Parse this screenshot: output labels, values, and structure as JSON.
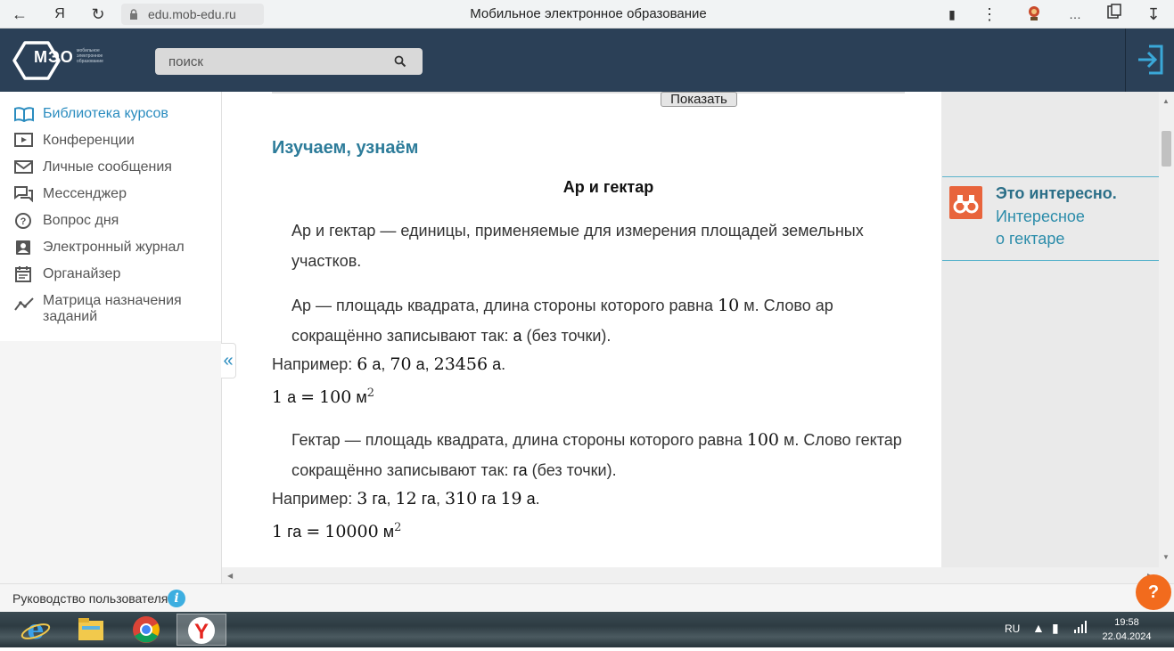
{
  "browser": {
    "url": "edu.mob-edu.ru",
    "title": "Мобильное электронное образование"
  },
  "header": {
    "logo_text": "МЭО",
    "logo_subtitle": "мобильное электронное образование",
    "search_placeholder": "поиск"
  },
  "sidebar": {
    "items": [
      {
        "label": "Библиотека курсов",
        "icon": "book-icon",
        "active": true
      },
      {
        "label": "Конференции",
        "icon": "video-play-icon"
      },
      {
        "label": "Личные сообщения",
        "icon": "mail-icon"
      },
      {
        "label": "Мессенджер",
        "icon": "chat-icon"
      },
      {
        "label": "Вопрос дня",
        "icon": "question-icon"
      },
      {
        "label": "Электронный журнал",
        "icon": "journal-icon"
      },
      {
        "label": "Органайзер",
        "icon": "calendar-icon"
      },
      {
        "label": "Матрица назначения заданий",
        "icon": "trend-icon"
      }
    ],
    "collapse_label": "«"
  },
  "content": {
    "show_button": "Показать",
    "section_title": "Изучаем, узнаём",
    "lesson_title": "Ар и гектар",
    "p1": "Ар и гектар — единицы, применяемые для измерения площадей земельных участков.",
    "p2_a": "Ар — площадь квадрата, длина стороны которого равна ",
    "p2_num": "10",
    "p2_unit": " м",
    "p2_b": ". Слово ар сокращённо записывают так: ",
    "p2_abbr": "а",
    "p2_c": " (без точки).",
    "ex1_label": "Например: ",
    "ex1_v1": "6",
    "ex1_v2": "70",
    "ex1_v3": "23456",
    "ex1_unit": "а",
    "eq1_l": "1",
    "eq1_lu": "а",
    "eq1_r": "100",
    "eq1_ru": "м",
    "p3_a": "Гектар — площадь квадрата, длина стороны которого равна ",
    "p3_num": "100",
    "p3_unit": " м",
    "p3_b": ". Слово гектар сокращённо записывают так: ",
    "p3_abbr": "га",
    "p3_c": " (без точки).",
    "ex2_label": "Например: ",
    "ex2_v1": "3",
    "ex2_v2": "12",
    "ex2_v3a": "310",
    "ex2_v3b": "19",
    "ex2_unit_ga": "га",
    "ex2_unit_a": "а",
    "eq2_l": "1",
    "eq2_lu": "га",
    "eq2_r": "10000",
    "eq2_ru": "м",
    "exp": "2"
  },
  "info_panel": {
    "heading": "Это интересно.",
    "link_line1": "Интересное",
    "link_line2": "о гектаре"
  },
  "footer": {
    "guide": "Руководство пользователя",
    "help": "?"
  },
  "taskbar": {
    "lang": "RU",
    "time": "19:58",
    "date": "22.04.2024"
  },
  "colors": {
    "header_bg": "#2b4057",
    "accent": "#2a8cbf",
    "orange": "#f26b1d"
  }
}
